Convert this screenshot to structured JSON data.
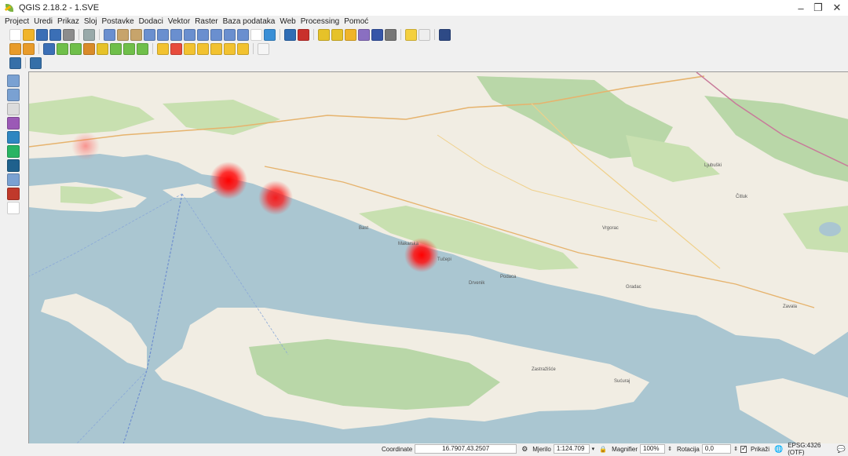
{
  "window": {
    "title": "QGIS 2.18.2 - 1.SVE",
    "minimize_glyph": "–",
    "maximize_glyph": "❐",
    "close_glyph": "✕"
  },
  "menu": [
    "Project",
    "Uredi",
    "Prikaz",
    "Sloj",
    "Postavke",
    "Dodaci",
    "Vektor",
    "Raster",
    "Baza podataka",
    "Web",
    "Processing",
    "Pomoć"
  ],
  "toolbar_icons": {
    "row1": [
      "new-project-icon",
      "open-project-icon",
      "save-project-icon",
      "save-as-icon",
      "print-composer-icon",
      "composer-manager-icon",
      "touch-zoom-icon",
      "pan-icon",
      "pan-to-selection-icon",
      "zoom-in-icon",
      "zoom-out-icon",
      "zoom-full-icon",
      "zoom-to-layer-icon",
      "zoom-to-selection-icon",
      "zoom-last-icon",
      "zoom-next-icon",
      "zoom-native-icon",
      "new-map-view-icon",
      "refresh-icon",
      "identify-icon",
      "run-action-icon",
      "select-feature-icon",
      "deselect-icon",
      "open-attribute-table-icon",
      "statistics-icon",
      "sum-icon",
      "measure-icon",
      "map-tips-icon",
      "text-annotation-icon",
      "qgis-help-icon"
    ],
    "row2": [
      "current-edits-icon",
      "toggle-editing-icon",
      "save-layer-edits-icon",
      "add-feature-icon",
      "move-feature-icon",
      "node-tool-icon",
      "delete-selected-icon",
      "cut-features-icon",
      "copy-features-icon",
      "paste-features-icon",
      "label-toolbar-icon",
      "diagram-icon",
      "label-pin-icon",
      "label-show-hide-icon",
      "label-move-icon",
      "label-rotate-icon",
      "label-change-icon",
      "csv-import-icon"
    ],
    "row3": [
      "python-console-icon",
      "python-plugin-icon"
    ]
  },
  "dock_icons": [
    "add-vector-layer-icon",
    "add-raster-layer-icon",
    "add-delimited-text-icon",
    "add-spatialite-icon",
    "add-wms-icon",
    "add-wfs-icon",
    "add-wcs-icon",
    "add-virtual-layer-icon",
    "add-oracle-icon",
    "new-shapefile-icon"
  ],
  "map": {
    "sea_color": "#aac6d1",
    "land_color": "#f1ede3",
    "forest_color": "#b9d7a8",
    "park_color": "#c8e0b0",
    "hotspot_color": "#ff0000",
    "places": [
      "Drvenik",
      "Podaca",
      "Gradac",
      "Zastražišće",
      "Sućuraj",
      "Makarska",
      "Tučepi",
      "Bast",
      "Vrgorac",
      "Čitluk",
      "Ljubuški",
      "Zavala"
    ]
  },
  "status": {
    "coordinate_label": "Coordinate",
    "coordinate_value": "16.7907,43.2507",
    "scale_label": "Mjerilo",
    "scale_value": "1:124.709",
    "magnifier_label": "Magnifier",
    "magnifier_value": "100%",
    "rotation_label": "Rotacija",
    "rotation_value": "0,0",
    "render_label": "Prikaži",
    "crs_label": "EPSG:4326 (OTF)"
  }
}
